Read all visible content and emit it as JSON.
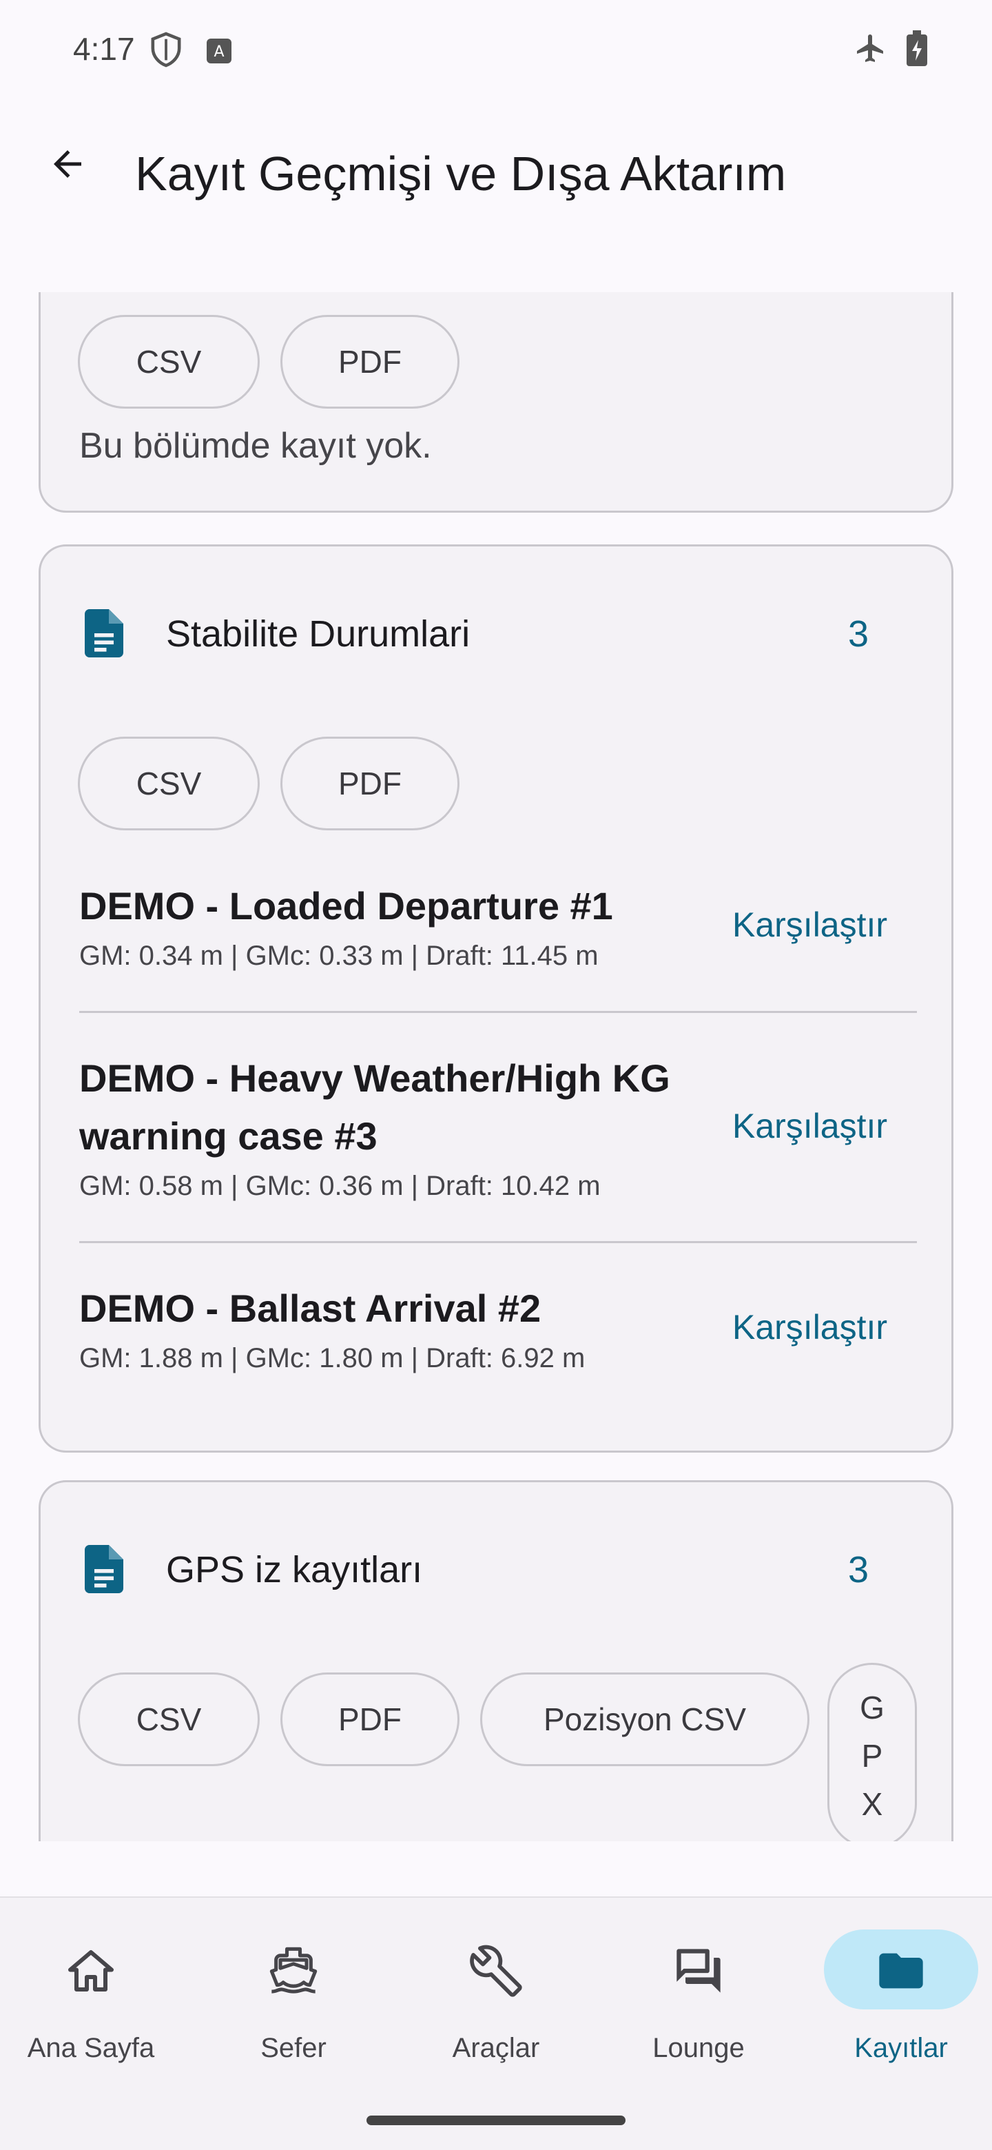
{
  "status_bar": {
    "time": "4:17"
  },
  "app_bar": {
    "title": "Kayıt Geçmişi ve Dışa Aktarım"
  },
  "partial_card": {
    "chips": [
      "CSV",
      "PDF"
    ],
    "empty_text": "Bu bölümde kayıt yok."
  },
  "stability_card": {
    "icon": "document-icon",
    "title": "Stabilite Durumlari",
    "count": "3",
    "chips": [
      "CSV",
      "PDF"
    ],
    "rows": [
      {
        "title": "DEMO - Loaded Departure #1",
        "subtitle": "GM: 0.34 m | GMc: 0.33 m | Draft: 11.45 m",
        "action": "Karşılaştır"
      },
      {
        "title": "DEMO - Heavy Weather/High KG warning case #3",
        "subtitle": "GM: 0.58 m | GMc: 0.36 m | Draft: 10.42 m",
        "action": "Karşılaştır"
      },
      {
        "title": "DEMO - Ballast Arrival #2",
        "subtitle": "GM: 1.88 m | GMc: 1.80 m | Draft: 6.92 m",
        "action": "Karşılaştır"
      }
    ]
  },
  "gps_card": {
    "icon": "document-icon",
    "title": "GPS iz kayıtları",
    "count": "3",
    "chips": [
      "CSV",
      "PDF",
      "Pozisyon CSV"
    ],
    "chip_vertical": [
      "G",
      "P",
      "X"
    ]
  },
  "bottom_nav": {
    "items": [
      {
        "label": "Ana Sayfa",
        "icon": "home-icon",
        "active": false
      },
      {
        "label": "Sefer",
        "icon": "ship-icon",
        "active": false
      },
      {
        "label": "Araçlar",
        "icon": "wrench-icon",
        "active": false
      },
      {
        "label": "Lounge",
        "icon": "chat-icon",
        "active": false
      },
      {
        "label": "Kayıtlar",
        "icon": "folder-icon",
        "active": true
      }
    ]
  },
  "colors": {
    "accent": "#0d6485",
    "indicator": "#bfe8f8",
    "card_bg": "#f4f2f6",
    "outline": "#c9c7cd"
  }
}
